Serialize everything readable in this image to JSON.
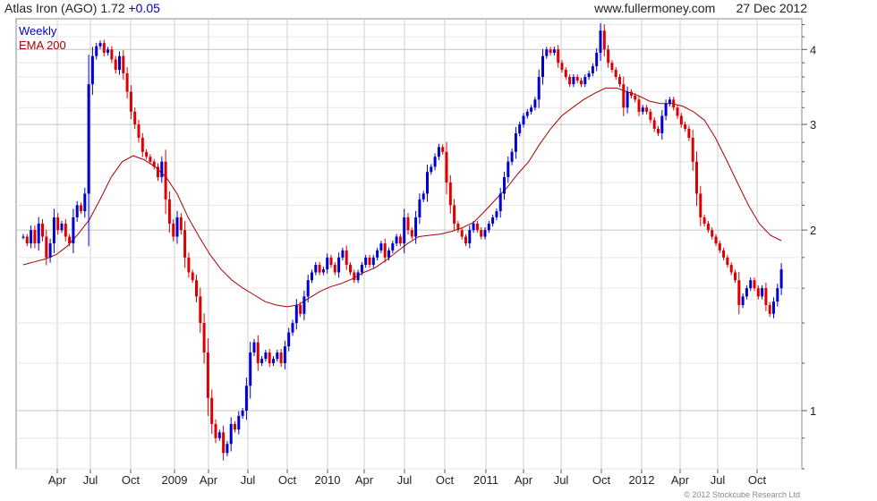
{
  "header": {
    "symbol": "Atlas Iron (AGO)",
    "price": "1.72",
    "change": "+0.05",
    "site": "www.fullermoney.com",
    "date": "27 Dec 2012"
  },
  "legend": {
    "weekly": "Weekly",
    "ema": "EMA 200"
  },
  "copyright": "© 2012 Stockcube Research Ltd",
  "colors": {
    "up": "#0000cc",
    "down": "#dd0000",
    "ema": "#aa0000",
    "grid": "#cfcfcf",
    "change": "#0000cc"
  },
  "chart_data": {
    "type": "candlestick",
    "scale": "log",
    "ylim": [
      0.8,
      4.5
    ],
    "y_ticks": [
      1,
      2,
      3,
      4
    ],
    "x_tick_labels": [
      "Apr",
      "Jul",
      "Oct",
      "2009",
      "Apr",
      "Jul",
      "Oct",
      "2010",
      "Apr",
      "Jul",
      "Oct",
      "2011",
      "Apr",
      "Jul",
      "Oct",
      "2012",
      "Apr",
      "Jul",
      "Oct"
    ],
    "series": [
      {
        "name": "Weekly",
        "kind": "price",
        "close": [
          1.95,
          1.9,
          2.0,
          1.9,
          2.05,
          1.95,
          1.8,
          1.9,
          2.1,
          2.0,
          2.05,
          1.95,
          1.9,
          2.1,
          2.2,
          2.15,
          2.3,
          3.5,
          3.9,
          4.05,
          4.1,
          3.95,
          4.0,
          3.85,
          3.7,
          3.9,
          3.65,
          3.4,
          3.15,
          3.0,
          2.85,
          2.7,
          2.65,
          2.6,
          2.55,
          2.45,
          2.6,
          2.25,
          2.05,
          1.95,
          2.1,
          2.0,
          1.8,
          1.7,
          1.65,
          1.55,
          1.4,
          1.25,
          1.05,
          0.95,
          0.9,
          0.92,
          0.85,
          0.88,
          0.95,
          0.93,
          0.98,
          1.0,
          1.1,
          1.25,
          1.3,
          1.2,
          1.22,
          1.25,
          1.2,
          1.22,
          1.25,
          1.2,
          1.28,
          1.35,
          1.4,
          1.5,
          1.45,
          1.55,
          1.65,
          1.7,
          1.75,
          1.7,
          1.72,
          1.8,
          1.75,
          1.7,
          1.8,
          1.85,
          1.75,
          1.7,
          1.65,
          1.7,
          1.75,
          1.8,
          1.75,
          1.8,
          1.85,
          1.9,
          1.8,
          1.85,
          1.9,
          1.95,
          1.9,
          2.1,
          2.0,
          1.95,
          2.1,
          2.25,
          2.3,
          2.5,
          2.55,
          2.65,
          2.75,
          2.7,
          2.4,
          2.2,
          2.05,
          2.0,
          1.95,
          1.9,
          2.0,
          2.05,
          2.0,
          1.95,
          2.0,
          2.05,
          2.1,
          2.15,
          2.3,
          2.45,
          2.6,
          2.7,
          2.9,
          3.0,
          3.1,
          3.15,
          3.2,
          3.3,
          3.6,
          3.9,
          4.0,
          3.95,
          4.0,
          3.8,
          3.7,
          3.6,
          3.5,
          3.6,
          3.55,
          3.5,
          3.6,
          3.65,
          3.75,
          3.95,
          4.3,
          4.0,
          3.8,
          3.7,
          3.6,
          3.5,
          3.2,
          3.4,
          3.35,
          3.3,
          3.15,
          3.2,
          3.15,
          3.05,
          2.95,
          2.9,
          3.1,
          3.25,
          3.3,
          3.2,
          3.1,
          3.0,
          2.95,
          2.85,
          2.6,
          2.3,
          2.1,
          2.05,
          2.0,
          1.95,
          1.9,
          1.85,
          1.8,
          1.75,
          1.7,
          1.65,
          1.5,
          1.55,
          1.6,
          1.65,
          1.6,
          1.55,
          1.6,
          1.5,
          1.45,
          1.52,
          1.6,
          1.72
        ]
      },
      {
        "name": "EMA 200",
        "kind": "ema",
        "values": [
          1.75,
          1.77,
          1.79,
          1.82,
          1.88,
          1.97,
          2.08,
          2.25,
          2.45,
          2.6,
          2.66,
          2.62,
          2.55,
          2.45,
          2.3,
          2.1,
          1.95,
          1.82,
          1.72,
          1.65,
          1.6,
          1.56,
          1.52,
          1.5,
          1.49,
          1.5,
          1.54,
          1.58,
          1.61,
          1.63,
          1.66,
          1.7,
          1.73,
          1.78,
          1.84,
          1.9,
          1.95,
          1.96,
          1.97,
          1.99,
          2.02,
          2.06,
          2.15,
          2.25,
          2.35,
          2.48,
          2.6,
          2.78,
          2.95,
          3.1,
          3.2,
          3.3,
          3.38,
          3.45,
          3.45,
          3.4,
          3.35,
          3.28,
          3.25,
          3.25,
          3.22,
          3.15,
          3.05,
          2.85,
          2.62,
          2.4,
          2.2,
          2.05,
          1.96,
          1.92
        ]
      }
    ]
  }
}
